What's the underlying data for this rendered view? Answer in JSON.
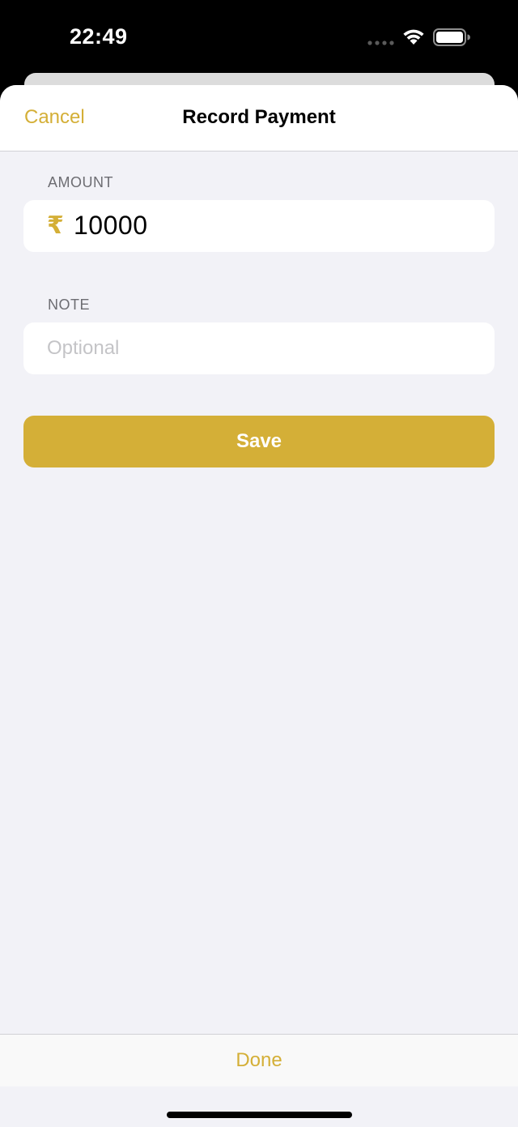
{
  "status_bar": {
    "time": "22:49",
    "icons": [
      "signal-icon",
      "wifi-icon",
      "battery-icon"
    ]
  },
  "nav": {
    "cancel_label": "Cancel",
    "title": "Record Payment"
  },
  "amount": {
    "label": "AMOUNT",
    "currency_symbol": "₹",
    "value": "10000"
  },
  "note": {
    "label": "NOTE",
    "placeholder": "Optional",
    "value": ""
  },
  "save_label": "Save",
  "toolbar": {
    "done_label": "Done"
  },
  "colors": {
    "accent": "#d4af37",
    "background": "#f2f2f7",
    "field": "#ffffff",
    "label": "#6d6d72"
  }
}
